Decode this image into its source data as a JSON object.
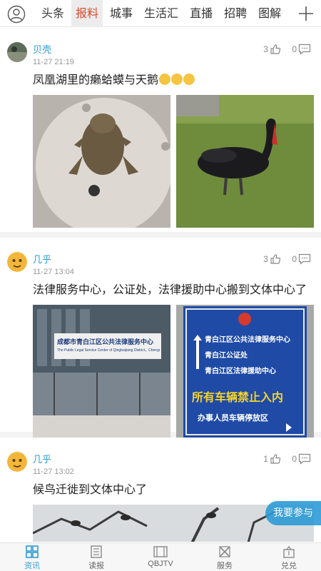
{
  "nav": {
    "tabs": [
      "头条",
      "报料",
      "城事",
      "生活汇",
      "直播",
      "招聘",
      "图解"
    ],
    "active_tab": "报料"
  },
  "posts": [
    {
      "author": "贝壳",
      "time": "11-27 21:19",
      "likes": "3",
      "comments": "0",
      "text": "凤凰湖里的癞蛤蟆与天鹅",
      "images": [
        {
          "label": ""
        },
        {
          "label": ""
        }
      ]
    },
    {
      "author": "几乎",
      "time": "11-27 13:04",
      "likes": "3",
      "comments": "0",
      "text": "法律服务中心，公证处，法律援助中心搬到文体中心了",
      "images": [
        {
          "building_sign": "成都市青白江区公共法律服务中心",
          "building_sign_en": "The Public Legal Service Center of Qingbaijiang District，Chengdu"
        },
        {
          "sign_lines": [
            "青白江区公共法律服务中心",
            "青白江公证处",
            "青白江区法律援助中心"
          ],
          "sign_warning": "所有车辆禁止入内",
          "sign_parking": "办事人员车辆停放区"
        }
      ]
    },
    {
      "author": "几乎",
      "time": "11-27 13:02",
      "likes": "1",
      "comments": "0",
      "text": "候鸟迁徙到文体中心了"
    }
  ],
  "join_button": "我要参与",
  "bottom_nav": [
    {
      "label": "资讯",
      "icon": "grid-icon",
      "active": true
    },
    {
      "label": "读报",
      "icon": "newspaper-icon",
      "active": false
    },
    {
      "label": "QBJTV",
      "icon": "tv-icon",
      "active": false
    },
    {
      "label": "服务",
      "icon": "service-icon",
      "active": false
    },
    {
      "label": "兑兑",
      "icon": "gift-icon",
      "active": false
    }
  ],
  "colors": {
    "accent": "#2d9bd6",
    "active_tab_text": "#d9482b"
  }
}
